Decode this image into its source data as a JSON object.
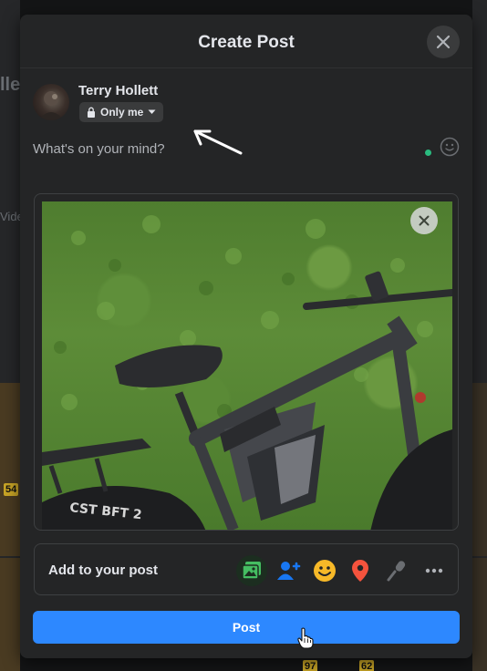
{
  "dialog": {
    "title": "Create Post"
  },
  "author": {
    "name": "Terry Hollett",
    "privacy_label": "Only me"
  },
  "composer": {
    "placeholder": "What's on your mind?"
  },
  "add_to_post": {
    "label": "Add to your post",
    "items": [
      {
        "icon": "photo-video-icon",
        "color": "#45bd62"
      },
      {
        "icon": "tag-people-icon",
        "color": "#1877f2"
      },
      {
        "icon": "feeling-activity-icon",
        "color": "#f7b928"
      },
      {
        "icon": "check-in-icon",
        "color": "#f5533d"
      },
      {
        "icon": "microphone-icon",
        "color": "#6b6e72"
      },
      {
        "icon": "more-icon",
        "color": "#b0b3b8"
      }
    ]
  },
  "post_button": {
    "label": "Post"
  },
  "background": {
    "partial_texts": [
      "lle",
      "Vide"
    ],
    "badges": [
      "54",
      "97",
      "62"
    ]
  },
  "colors": {
    "accent": "#2d88ff",
    "surface": "#242526",
    "button_bg": "#3a3b3c"
  }
}
